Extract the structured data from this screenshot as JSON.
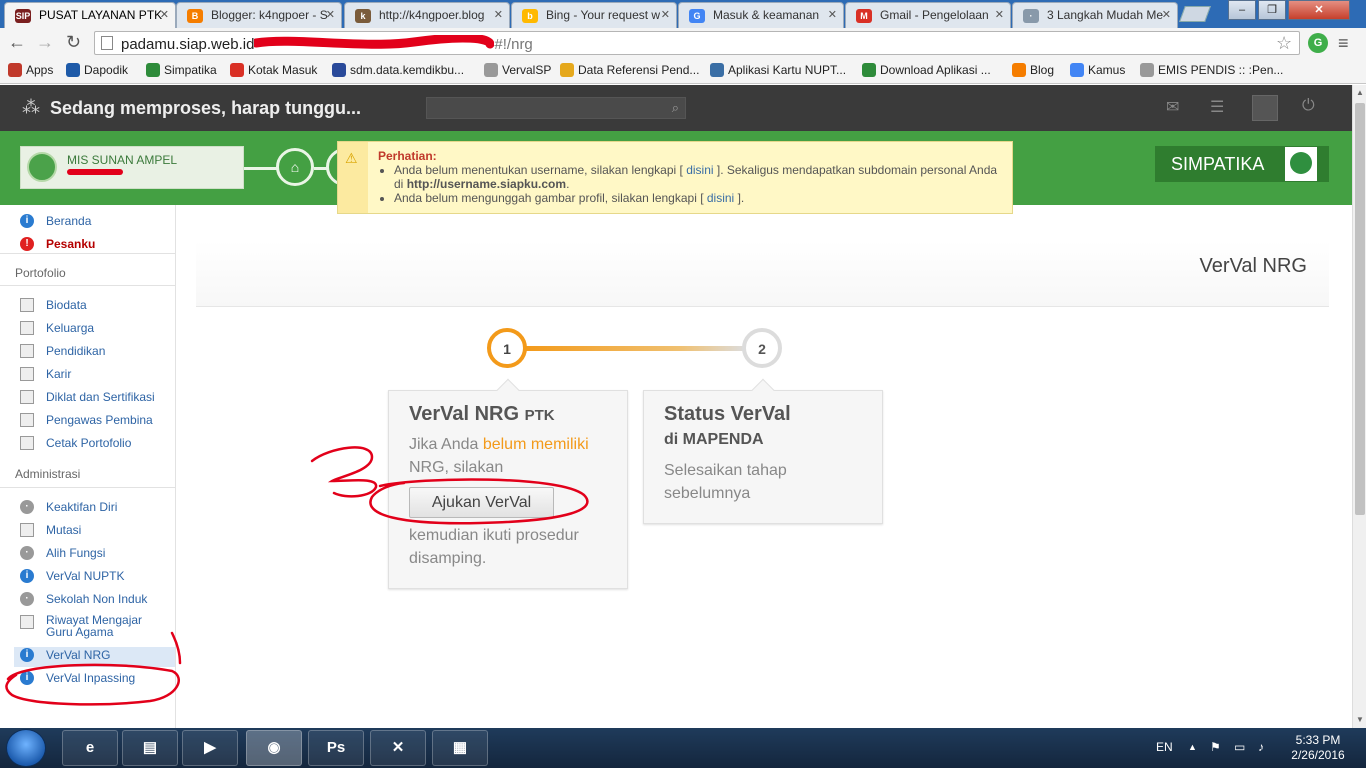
{
  "browser": {
    "tabs": [
      {
        "label": "PUSAT LAYANAN PTK",
        "fav": "SIP",
        "color": "#f4f4f4"
      },
      {
        "label": "Blogger: k4ngpoer - S",
        "fav": "B",
        "color": "#f57d00"
      },
      {
        "label": "http://k4ngpoer.blog",
        "fav": "k",
        "color": "#7a5b3a"
      },
      {
        "label": "Bing - Your request w",
        "fav": "b",
        "color": "#ffb900"
      },
      {
        "label": "Masuk & keamanan",
        "fav": "G",
        "color": "#4285f4"
      },
      {
        "label": "Gmail - Pengelolaan",
        "fav": "M",
        "color": "#d93025"
      },
      {
        "label": "3 Langkah Mudah Me",
        "fav": "·",
        "color": "#8899aa"
      }
    ],
    "url_host": "padamu.siap.web.id",
    "url_path": "#!/nrg",
    "window_controls": [
      "–",
      "❐",
      "✕"
    ],
    "nav": {
      "back": "←",
      "forward": "→",
      "reload": "↻"
    }
  },
  "bookmarks": [
    {
      "label": "Apps",
      "icon": "apps-icon",
      "color": "#c0392b"
    },
    {
      "label": "Dapodik",
      "icon": "globe-icon",
      "color": "#1e5aa8"
    },
    {
      "label": "Simpatika",
      "icon": "simpatika-icon",
      "color": "#2e8b3a"
    },
    {
      "label": "Kotak Masuk",
      "icon": "gmail-icon",
      "color": "#d93025"
    },
    {
      "label": "sdm.data.kemdikbu...",
      "icon": "shield-icon",
      "color": "#2a4a9a"
    },
    {
      "label": "VervalSP",
      "icon": "page-icon",
      "color": "#999999"
    },
    {
      "label": "Data Referensi Pend...",
      "icon": "globe-icon",
      "color": "#e5a81c"
    },
    {
      "label": "Aplikasi Kartu NUPT...",
      "icon": "globe-icon",
      "color": "#3a6ea5"
    },
    {
      "label": "Download Aplikasi ...",
      "icon": "simpatika-icon",
      "color": "#2e8b3a"
    },
    {
      "label": "Blog",
      "icon": "blogger-icon",
      "color": "#f57d00"
    },
    {
      "label": "Kamus",
      "icon": "google-icon",
      "color": "#4285f4"
    },
    {
      "label": "EMIS PENDIS :: :Pen...",
      "icon": "page-icon",
      "color": "#999999"
    }
  ],
  "topbar": {
    "processing": "Sedang memproses, harap tunggu..."
  },
  "school": {
    "name": "MIS SUNAN AMPEL"
  },
  "alert": {
    "title": "Perhatian:",
    "line1_pre": "Anda belum menentukan username, silakan lengkapi [ ",
    "line1_link": "disini",
    "line1_post": " ]. Sekaligus mendapatkan subdomain personal Anda di ",
    "line1_url": "http://username.siapku.com",
    "line1_end": ".",
    "line2_pre": "Anda belum mengunggah gambar profil, silakan lengkapi [ ",
    "line2_link": "disini",
    "line2_post": " ]."
  },
  "brand": "SIMPATIKA",
  "sidebar": {
    "top": [
      {
        "label": "Beranda",
        "icon": "info"
      },
      {
        "label": "Pesanku",
        "icon": "warn"
      }
    ],
    "portofolio_heading": "Portofolio",
    "portofolio": [
      "Biodata",
      "Keluarga",
      "Pendidikan",
      "Karir",
      "Diklat dan Sertifikasi",
      "Pengawas Pembina",
      "Cetak Portofolio"
    ],
    "administrasi_heading": "Administrasi",
    "administrasi": [
      {
        "label": "Keaktifan Diri",
        "icon": "grey"
      },
      {
        "label": "Mutasi",
        "icon": "doc"
      },
      {
        "label": "Alih Fungsi",
        "icon": "grey"
      },
      {
        "label": "VerVal NUPTK",
        "icon": "info"
      },
      {
        "label": "Sekolah Non Induk",
        "icon": "grey"
      },
      {
        "label": "Riwayat Mengajar Guru Agama",
        "icon": "doc"
      },
      {
        "label": "VerVal NRG",
        "icon": "info"
      },
      {
        "label": "VerVal Inpassing",
        "icon": "info"
      }
    ]
  },
  "main": {
    "title": "VerVal NRG",
    "step1": {
      "number": "1",
      "title": "VerVal NRG",
      "title_small": "PTK",
      "text_pre": "Jika Anda ",
      "text_hl": "belum memiliki",
      "text_post": " NRG, silakan",
      "button": "Ajukan VerVal",
      "text_after": "kemudian ikuti prosedur disamping."
    },
    "step2": {
      "number": "2",
      "title": "Status VerVal",
      "subtitle": "di MAPENDA",
      "text": "Selesaikan tahap sebelumnya"
    }
  },
  "taskbar": {
    "lang": "EN",
    "time": "5:33 PM",
    "date": "2/26/2016",
    "apps": [
      {
        "name": "ie-icon",
        "glyph": "e"
      },
      {
        "name": "explorer-icon",
        "glyph": "▤"
      },
      {
        "name": "media-player-icon",
        "glyph": "▶"
      },
      {
        "name": "chrome-icon",
        "glyph": "◉"
      },
      {
        "name": "photoshop-icon",
        "glyph": "Ps"
      },
      {
        "name": "app-icon",
        "glyph": "✕"
      },
      {
        "name": "app-icon",
        "glyph": "▦"
      }
    ]
  }
}
